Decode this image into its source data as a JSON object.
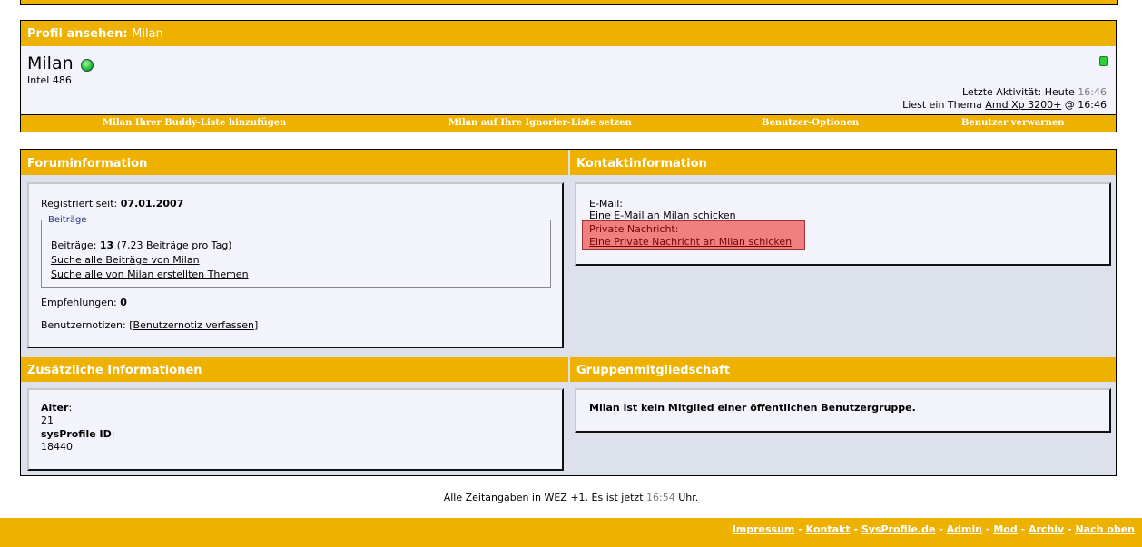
{
  "profile": {
    "header_label": "Profil ansehen",
    "header_name": "Milan",
    "username": "Milan",
    "user_title": "Intel 486",
    "last_activity_label": "Letzte Aktivität: Heute",
    "last_activity_time": "16:46",
    "reading_label": "Liest ein Thema",
    "reading_thread": "Amd Xp 3200+",
    "reading_time": "@ 16:46",
    "actions": {
      "buddy": "Milan Ihrer Buddy-Liste hinzufügen",
      "ignore": "Milan auf Ihre Ignorier-Liste setzen",
      "options": "Benutzer-Optionen",
      "warn": "Benutzer verwarnen"
    }
  },
  "forum_info": {
    "title": "Foruminformation",
    "registered_label": "Registriert seit:",
    "registered_value": "07.01.2007",
    "posts_legend": "Beiträge",
    "posts_label": "Beiträge:",
    "posts_value": "13",
    "posts_per_day": "(7,23 Beiträge pro Tag)",
    "find_posts": "Suche alle Beiträge von Milan",
    "find_threads": "Suche alle von Milan erstellten Themen",
    "referrals_label": "Empfehlungen:",
    "referrals_value": "0",
    "notes_label": "Benutzernotizen:",
    "notes_link": "Benutzernotiz verfassen"
  },
  "contact_info": {
    "title": "Kontaktinformation",
    "email_label": "E-Mail:",
    "email_link": "Eine E-Mail an Milan schicken",
    "pm_label": "Private Nachricht:",
    "pm_link": "Eine Private Nachricht an Milan schicken"
  },
  "extra_info": {
    "title": "Zusätzliche Informationen",
    "age_label": "Alter",
    "age_value": "21",
    "id_label": "sysProfile ID",
    "id_value": "18440"
  },
  "groups": {
    "title": "Gruppenmitgliedschaft",
    "text": "Milan ist kein Mitglied einer öffentlichen Benutzergruppe."
  },
  "footer": {
    "time_prefix": "Alle Zeitangaben in WEZ +1. Es ist jetzt",
    "time_value": "16:54",
    "time_suffix": "Uhr.",
    "links": [
      "Impressum",
      "Kontakt",
      "SysProfile.de",
      "Admin",
      "Mod",
      "Archiv",
      "Nach oben"
    ]
  },
  "colors": {
    "header_bar": "#eeb100",
    "panel_bg": "#f3f3fb",
    "grid_bg": "#dde1ec",
    "pm_highlight": "#f08080"
  }
}
